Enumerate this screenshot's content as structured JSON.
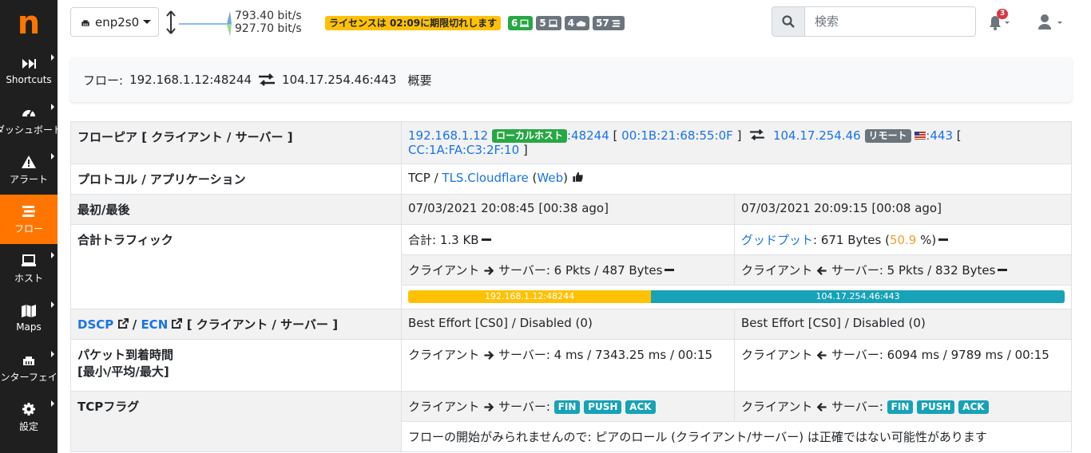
{
  "sidebar": {
    "logo": "n",
    "items": [
      {
        "label": "Shortcuts",
        "icon": "fast-forward-icon"
      },
      {
        "label": "ダッシュボード",
        "icon": "gauge-icon"
      },
      {
        "label": "アラート",
        "icon": "warning-icon"
      },
      {
        "label": "フロー",
        "icon": "stream-icon"
      },
      {
        "label": "ホスト",
        "icon": "laptop-icon"
      },
      {
        "label": "Maps",
        "icon": "map-icon"
      },
      {
        "label": "インターフェイス",
        "icon": "ethernet-icon"
      },
      {
        "label": "設定",
        "icon": "cog-icon"
      }
    ]
  },
  "topbar": {
    "interface": "enp2s0",
    "upload_rate": "793.40 bit/s",
    "download_rate": "927.70 bit/s",
    "license": "ライセンスは 02:09に期限切れします",
    "counters": [
      {
        "value": "6",
        "icon": "laptop-icon",
        "color": "#28a745"
      },
      {
        "value": "5",
        "icon": "laptop-icon",
        "color": "#6c757d"
      },
      {
        "value": "4",
        "icon": "cloud-icon",
        "color": "#6c757d"
      },
      {
        "value": "57",
        "icon": "stream-icon",
        "color": "#6c757d"
      }
    ],
    "search_placeholder": "検索",
    "notifications": "3"
  },
  "breadcrumb": {
    "prefix": "フロー:",
    "client": "192.168.1.12:48244",
    "server": "104.17.254.46:443",
    "suffix": "概要"
  },
  "table": {
    "peers": {
      "label": "フローピア [ クライアント / サーバー ]",
      "client_ip": "192.168.1.12",
      "client_tag": "ローカルホスト",
      "client_port": ":48244",
      "client_mac": "00:1B:21:68:55:0F",
      "server_ip": "104.17.254.46",
      "server_tag": "リモート",
      "server_port": ":443",
      "server_mac": "CC:1A:FA:C3:2F:10"
    },
    "protocol": {
      "label": "プロトコル / アプリケーション",
      "l4": "TCP",
      "app": "TLS.Cloudflare",
      "category": "Web"
    },
    "firstlast": {
      "label": "最初/最後",
      "first": "07/03/2021 20:08:45 [00:38 ago]",
      "last": "07/03/2021 20:09:15 [00:08 ago]"
    },
    "traffic": {
      "label": "合計トラフィック",
      "total_label": "合計:",
      "total": "1.3 KB",
      "goodput_label": "グッドプット",
      "goodput": ": 671 Bytes (",
      "goodput_pct": "50.9",
      "goodput_suffix": " %)",
      "c2s_label": "クライアント",
      "server_label": "サーバー:",
      "c2s": "6 Pkts / 487 Bytes",
      "s2c": "5 Pkts / 832 Bytes",
      "bar_client": "192.168.1.12:48244",
      "bar_server": "104.17.254.46:443",
      "bar_client_fraction": 0.37
    },
    "dscp": {
      "dscp": "DSCP",
      "ecn": "ECN",
      "rest": "[ クライアント / サーバー ]",
      "c2s": "Best Effort [CS0] / Disabled (0)",
      "s2c": "Best Effort [CS0] / Disabled (0)"
    },
    "iat": {
      "label1": "パケット到着時間",
      "label2": "[最小/平均/最大]",
      "c2s": "4 ms / 7343.25 ms / 00:15",
      "s2c": "6094 ms / 9789 ms / 00:15"
    },
    "tcpflags": {
      "label": "TCPフラグ",
      "flags": [
        "FIN",
        "PUSH",
        "ACK"
      ],
      "note": "フローの開始がみられませんので: ピアのロール (クライアント/サーバー) は正確ではない可能性があります"
    }
  }
}
